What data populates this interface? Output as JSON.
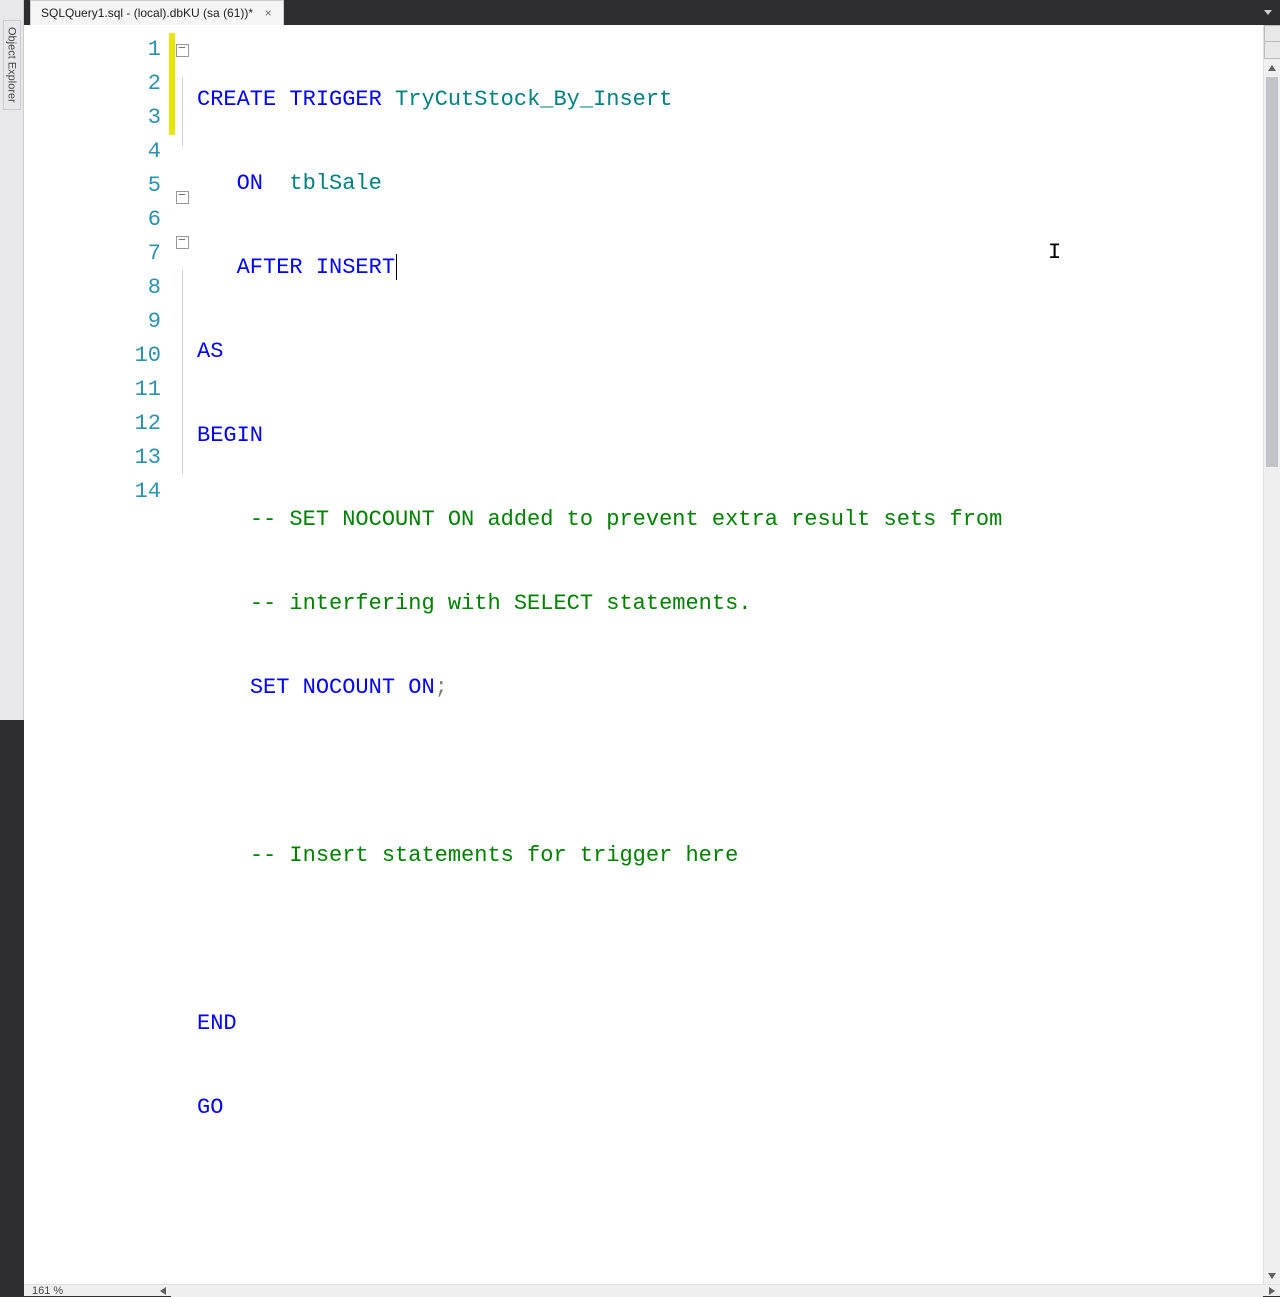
{
  "side_panel": {
    "tab_label": "Object Explorer"
  },
  "tab": {
    "title": "SQLQuery1.sql - (local).dbKU (sa (61))*",
    "close_glyph": "×"
  },
  "status": {
    "zoom": "161 %"
  },
  "editor": {
    "line_numbers": [
      "1",
      "2",
      "3",
      "4",
      "5",
      "6",
      "7",
      "8",
      "9",
      "10",
      "11",
      "12",
      "13",
      "14"
    ],
    "tokens": {
      "l1": {
        "a": "CREATE",
        "b": " ",
        "c": "TRIGGER",
        "d": " ",
        "e": "TryCutStock_By_Insert"
      },
      "l2": {
        "a": "   ",
        "b": "ON",
        "c": "  ",
        "d": "tblSale"
      },
      "l3": {
        "a": "   ",
        "b": "AFTER",
        "c": " ",
        "d": "INSERT"
      },
      "l4": {
        "a": "AS"
      },
      "l5": {
        "a": "BEGIN"
      },
      "l6": {
        "a": "    ",
        "b": "-- SET NOCOUNT ON added to prevent extra result sets from"
      },
      "l7": {
        "a": "    ",
        "b": "-- interfering with SELECT statements."
      },
      "l8": {
        "a": "    ",
        "b": "SET",
        "c": " ",
        "d": "NOCOUNT",
        "e": " ",
        "f": "ON",
        "g": ";"
      },
      "l9": {
        "a": ""
      },
      "l10": {
        "a": "    ",
        "b": "-- Insert statements for trigger here"
      },
      "l11": {
        "a": ""
      },
      "l12": {
        "a": "END"
      },
      "l13": {
        "a": "GO"
      },
      "l14": {
        "a": ""
      }
    },
    "change_marks": [
      true,
      true,
      true,
      false,
      false,
      false,
      false,
      false,
      false,
      false,
      false,
      false,
      false,
      false
    ],
    "fold": [
      "box",
      "line",
      "line",
      "spacer",
      "box",
      "box",
      "line",
      "line",
      "line",
      "line",
      "line",
      "line",
      "spacer",
      "spacer"
    ]
  }
}
